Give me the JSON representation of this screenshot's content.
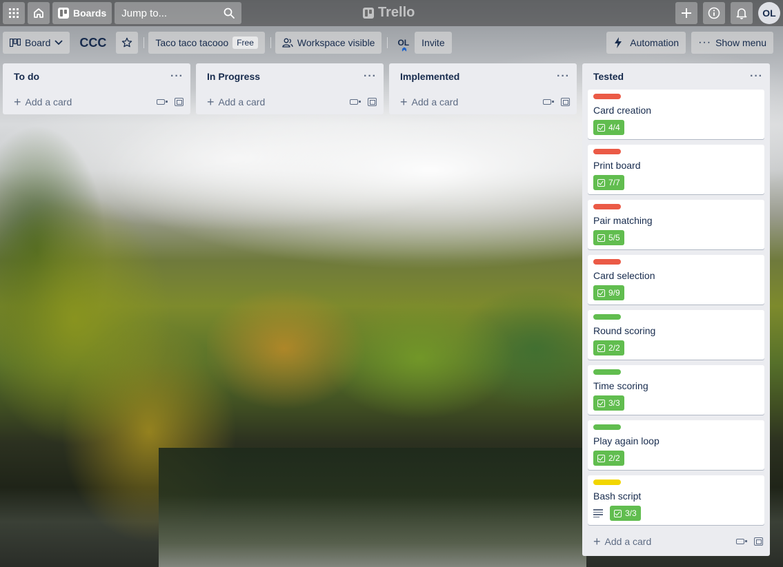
{
  "header": {
    "apps_icon": "grid-icon",
    "home_icon": "home-icon",
    "boards_label": "Boards",
    "search_placeholder": "Jump to...",
    "logo_text": "Trello",
    "avatar_initials": "OL"
  },
  "boardbar": {
    "view_label": "Board",
    "board_name": "CCC",
    "workspace_name": "Taco taco tacooo",
    "plan_badge": "Free",
    "visibility_label": "Workspace visible",
    "member_initials": "OL",
    "invite_label": "Invite",
    "automation_label": "Automation",
    "menu_label": "Show menu"
  },
  "lists": [
    {
      "title": "To do",
      "add_label": "Add a card",
      "cards": []
    },
    {
      "title": "In Progress",
      "add_label": "Add a card",
      "cards": []
    },
    {
      "title": "Implemented",
      "add_label": "Add a card",
      "cards": []
    },
    {
      "title": "Tested",
      "add_label": "Add a card",
      "cards": [
        {
          "title": "Card creation",
          "label_color": "#eb5a46",
          "checklist": "4/4"
        },
        {
          "title": "Print board",
          "label_color": "#eb5a46",
          "checklist": "7/7"
        },
        {
          "title": "Pair matching",
          "label_color": "#eb5a46",
          "checklist": "5/5"
        },
        {
          "title": "Card selection",
          "label_color": "#eb5a46",
          "checklist": "9/9"
        },
        {
          "title": "Round scoring",
          "label_color": "#61bd4f",
          "checklist": "2/2"
        },
        {
          "title": "Time scoring",
          "label_color": "#61bd4f",
          "checklist": "3/3"
        },
        {
          "title": "Play again loop",
          "label_color": "#61bd4f",
          "checklist": "2/2"
        },
        {
          "title": "Bash script",
          "label_color": "#f2d600",
          "checklist": "3/3",
          "has_description": true
        }
      ]
    }
  ]
}
